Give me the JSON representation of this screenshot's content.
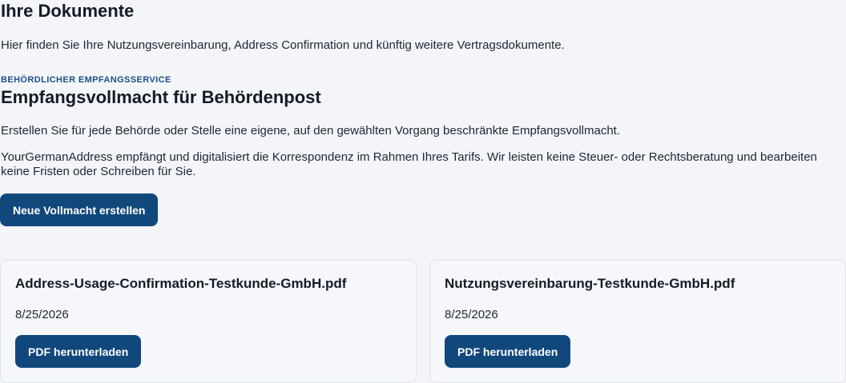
{
  "header": {
    "title": "Ihre Dokumente",
    "intro": "Hier finden Sie Ihre Nutzungsvereinbarung, Address Confirmation und künftig weitere Vertragsdokumente."
  },
  "service": {
    "eyebrow": "BEHÖRDLICHER EMPFANGSSERVICE",
    "title": "Empfangsvollmacht für Behördenpost",
    "description": "Erstellen Sie für jede Behörde oder Stelle eine eigene, auf den gewählten Vorgang beschränkte Empfangsvollmacht.",
    "disclaimer": "YourGermanAddress empfängt und digitalisiert die Korrespondenz im Rahmen Ihres Tarifs. Wir leisten keine Steuer- oder Rechtsberatung und bearbeiten keine Fristen oder Schreiben für Sie.",
    "create_button": "Neue Vollmacht erstellen"
  },
  "documents": [
    {
      "filename": "Address-Usage-Confirmation-Testkunde-GmbH.pdf",
      "date": "8/25/2026",
      "download_label": "PDF herunterladen"
    },
    {
      "filename": "Nutzungsvereinbarung-Testkunde-GmbH.pdf",
      "date": "8/25/2026",
      "download_label": "PDF herunterladen"
    }
  ],
  "colors": {
    "background": "#f3f5f9",
    "primary": "#11487c",
    "eyebrow": "#1c4f82",
    "card_border": "#dfe4ec"
  }
}
